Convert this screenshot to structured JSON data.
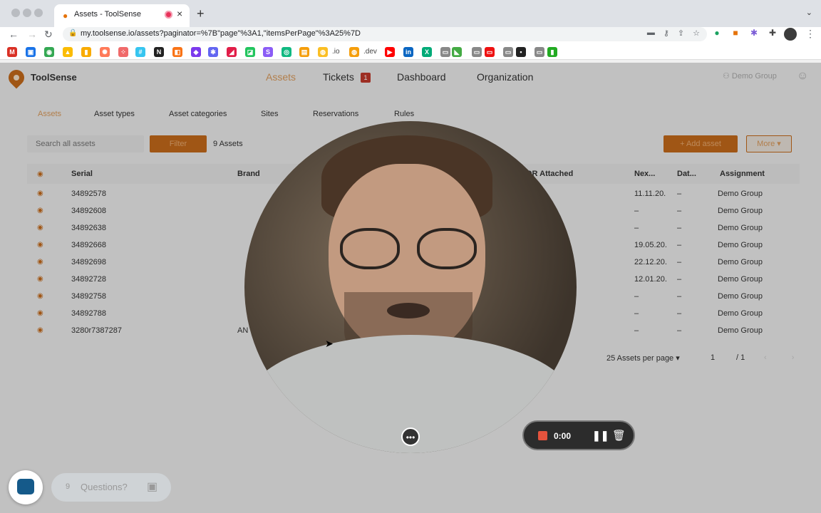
{
  "browser": {
    "tab_title": "Assets - ToolSense",
    "url": "my.toolsense.io/assets?paginator=%7B\"page\"%3A1,\"itemsPerPage\"%3A25%7D",
    "bookmark_io": ".io",
    "bookmark_dev": ".dev"
  },
  "app": {
    "brand": "ToolSense",
    "nav": [
      "Assets",
      "Tickets",
      "Dashboard",
      "Organization"
    ],
    "tickets_badge": "1",
    "org_name": "Demo Group",
    "subnav": [
      "Assets",
      "Asset types",
      "Asset categories",
      "Sites",
      "Reservations",
      "Rules"
    ],
    "search_placeholder": "Search all assets",
    "filter_label": "Filter",
    "asset_count": "9 Assets",
    "add_label": "+ Add asset",
    "more_label": "More ▾",
    "columns": {
      "serial": "Serial",
      "brand": "Brand",
      "attached": "QR Attached",
      "next": "Nex...",
      "date": "Dat...",
      "assignment": "Assignment"
    },
    "rows": [
      {
        "serial": "34892578",
        "brand": "",
        "next": "11.11.20.",
        "date": "–",
        "assignment": "Demo Group"
      },
      {
        "serial": "34892608",
        "brand": "",
        "next": "–",
        "date": "–",
        "assignment": "Demo Group"
      },
      {
        "serial": "34892638",
        "brand": "",
        "next": "–",
        "date": "–",
        "assignment": "Demo Group"
      },
      {
        "serial": "34892668",
        "brand": "",
        "next": "19.05.20.",
        "date": "–",
        "assignment": "Demo Group"
      },
      {
        "serial": "34892698",
        "brand": "",
        "next": "22.12.20.",
        "date": "–",
        "assignment": "Demo Group"
      },
      {
        "serial": "34892728",
        "brand": "",
        "next": "12.01.20.",
        "date": "–",
        "assignment": "Demo Group"
      },
      {
        "serial": "34892758",
        "brand": "",
        "next": "–",
        "date": "–",
        "assignment": "Demo Group"
      },
      {
        "serial": "34892788",
        "brand": "",
        "next": "–",
        "date": "–",
        "assignment": "Demo Group"
      },
      {
        "serial": "3280r7387287",
        "brand": "AN",
        "next": "–",
        "date": "–",
        "assignment": "Demo Group"
      }
    ],
    "pager": {
      "per_page": "25 Assets per page ▾",
      "page": "1",
      "total": "/ 1",
      "arrows": "‹ ›"
    }
  },
  "recorder": {
    "time": "0:00",
    "more": "•••"
  },
  "chat": {
    "questions_label": "Questions?",
    "questions_mark": "9"
  },
  "icons": {
    "eye": "eye-icon",
    "lock": "lock-icon",
    "user": "user-icon",
    "trash": "trash-icon",
    "pause": "pause-icon"
  },
  "colors": {
    "accent": "#c46a1a",
    "accent_text": "#d99a5c",
    "badge": "#c0392b",
    "record": "#e5533d"
  }
}
